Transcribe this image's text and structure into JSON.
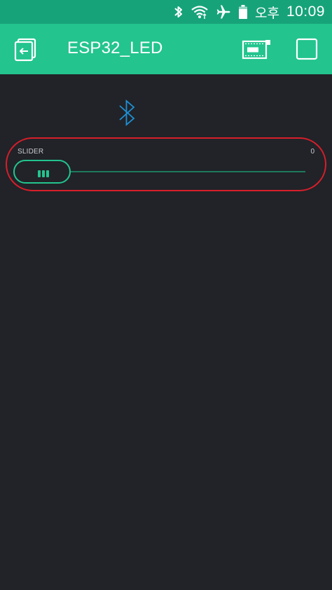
{
  "status_bar": {
    "ampm": "오후",
    "time": "10:09",
    "icons": [
      "bluetooth-icon",
      "wifi-icon",
      "airplane-mode-icon",
      "battery-icon"
    ]
  },
  "app_bar": {
    "title": "ESP32_LED",
    "icons": [
      "back-icon",
      "device-icon",
      "stop-icon"
    ]
  },
  "widgets": {
    "bluetooth": {
      "icon": "bluetooth-icon"
    },
    "slider": {
      "label": "SLIDER",
      "value": "0",
      "level": 0
    }
  },
  "colors": {
    "status_bar": "#17a37a",
    "app_bar": "#23c48e",
    "background": "#212328",
    "accent": "#23c48e",
    "bluetooth": "#1e90d6",
    "highlight": "#d81e2a"
  }
}
